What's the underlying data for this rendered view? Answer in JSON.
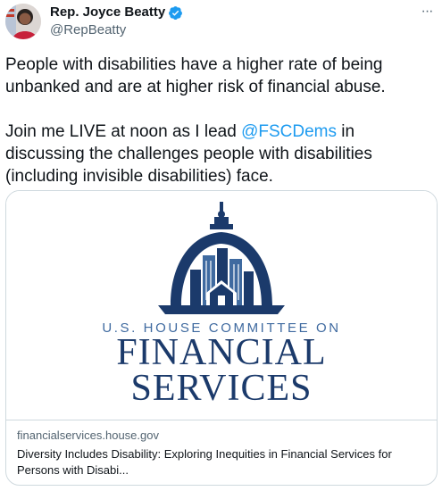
{
  "author": {
    "display_name": "Rep. Joyce Beatty",
    "handle": "@RepBeatty",
    "verified_icon": "verified-badge-icon",
    "avatar_icon": "profile-photo"
  },
  "more_menu": {
    "icon": "more-horizontal-icon",
    "label": "···"
  },
  "tweet": {
    "p1": "People with disabilities have a higher rate of being unbanked and are at higher risk of financial abuse.",
    "p2_before": "Join me LIVE at noon as I lead ",
    "p2_mention": "@FSCDems",
    "p2_after": " in discussing the challenges people with disabilities (including invisible disabilities) face."
  },
  "card": {
    "logo_subtitle": "U.S. HOUSE COMMITTEE ON",
    "logo_line1": "FINANCIAL",
    "logo_line2": "SERVICES",
    "domain": "financialservices.house.gov",
    "title": "Diversity Includes Disability: Exploring Inequities in Financial Services for Persons with Disabi..."
  },
  "colors": {
    "link": "#1d9bf0",
    "logo_navy": "#1b3a6b",
    "logo_blue": "#3f6aa0",
    "verified": "#1d9bf0"
  }
}
